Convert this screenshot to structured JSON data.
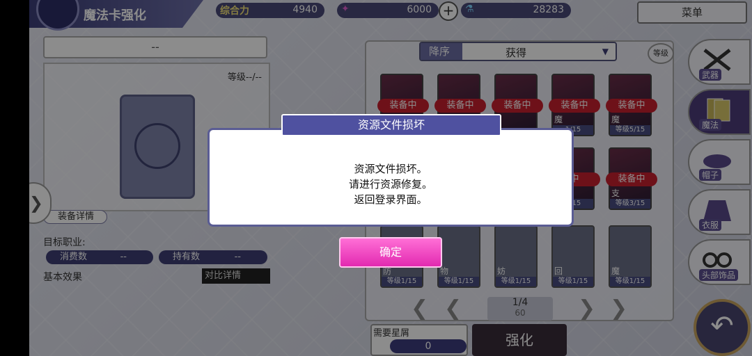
{
  "header": {
    "title": "魔法卡强化",
    "power_label": "综合力",
    "power_value": "4940",
    "currency1_value": "6000",
    "currency2_value": "28283",
    "menu_label": "菜单"
  },
  "left_panel": {
    "name_placeholder": "--",
    "level_text": "等级--/--",
    "equip_detail_label": "装备详情",
    "target_job_label": "目标职业:",
    "cost_label": "消费数",
    "cost_value": "--",
    "owned_label": "持有数",
    "owned_value": "--",
    "base_effect_label": "基本效果",
    "compare_label": "对比详情"
  },
  "sort": {
    "order_label": "降序",
    "sort_label": "获得",
    "circle_label": "等级"
  },
  "cards": [
    {
      "tag": "装备中",
      "level": "",
      "sym": ""
    },
    {
      "tag": "装备中",
      "level": "",
      "sym": ""
    },
    {
      "tag": "装备中",
      "level": "",
      "sym": ""
    },
    {
      "tag": "装备中",
      "level": "1/15",
      "sym": "魔"
    },
    {
      "tag": "装备中",
      "level": "等级5/15",
      "sym": "魔"
    },
    {
      "tag": "",
      "level": "",
      "sym": ""
    },
    {
      "tag": "",
      "level": "",
      "sym": ""
    },
    {
      "tag": "",
      "level": "",
      "sym": ""
    },
    {
      "tag": "中",
      "level": "2/15",
      "sym": ""
    },
    {
      "tag": "装备中",
      "level": "等级3/15",
      "sym": "支"
    },
    {
      "tag": "",
      "level": "等级1/15",
      "sym": "防"
    },
    {
      "tag": "",
      "level": "等级1/15",
      "sym": "物"
    },
    {
      "tag": "",
      "level": "等级1/15",
      "sym": "妨"
    },
    {
      "tag": "",
      "level": "等级1/15",
      "sym": "回"
    },
    {
      "tag": "",
      "level": "等级1/15",
      "sym": "魔"
    }
  ],
  "pager": {
    "page": "1/4",
    "count": "60"
  },
  "bottom": {
    "need_label": "需要星屑",
    "need_value": "0",
    "strengthen_label": "强化"
  },
  "side_tabs": [
    {
      "label": "武器",
      "icon": "sword-icon"
    },
    {
      "label": "魔法",
      "icon": "cards-icon"
    },
    {
      "label": "帽子",
      "icon": "hat-icon"
    },
    {
      "label": "衣服",
      "icon": "clothes-icon"
    },
    {
      "label": "头部饰品",
      "icon": "glasses-icon"
    }
  ],
  "dialog": {
    "title": "资源文件损坏",
    "line1": "资源文件损坏。",
    "line2": "请进行资源修复。",
    "line3": "返回登录界面。",
    "ok_label": "确定"
  }
}
